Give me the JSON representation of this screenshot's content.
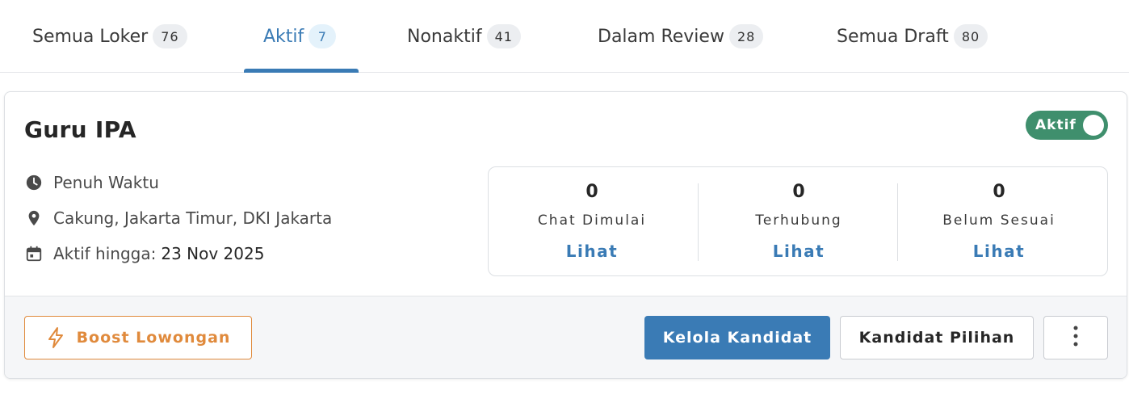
{
  "tabs": [
    {
      "label": "Semua Loker",
      "count": "76"
    },
    {
      "label": "Aktif",
      "count": "7"
    },
    {
      "label": "Nonaktif",
      "count": "41"
    },
    {
      "label": "Dalam Review",
      "count": "28"
    },
    {
      "label": "Semua Draft",
      "count": "80"
    }
  ],
  "active_tab": "Aktif",
  "job": {
    "title": "Guru IPA",
    "status_toggle": {
      "label": "Aktif",
      "on": true
    },
    "employment_type": "Penuh Waktu",
    "location": "Cakung, Jakarta Timur, DKI Jakarta",
    "active_until_label": "Aktif hingga:",
    "active_until_value": "23 Nov 2025",
    "stats": [
      {
        "value": "0",
        "label": "Chat Dimulai",
        "link": "Lihat"
      },
      {
        "value": "0",
        "label": "Terhubung",
        "link": "Lihat"
      },
      {
        "value": "0",
        "label": "Belum Sesuai",
        "link": "Lihat"
      }
    ],
    "actions": {
      "boost": "Boost Lowongan",
      "manage": "Kelola Kandidat",
      "shortlist": "Kandidat Pilihan"
    }
  },
  "icons": {
    "employment_type": "clock-icon",
    "location": "location-pin-icon",
    "active_until": "calendar-icon",
    "boost": "lightning-icon",
    "more": "more-vertical-icon"
  },
  "colors": {
    "accent": "#3a7bb5",
    "toggle_on": "#3f8f6d",
    "boost": "#e08a3c"
  }
}
